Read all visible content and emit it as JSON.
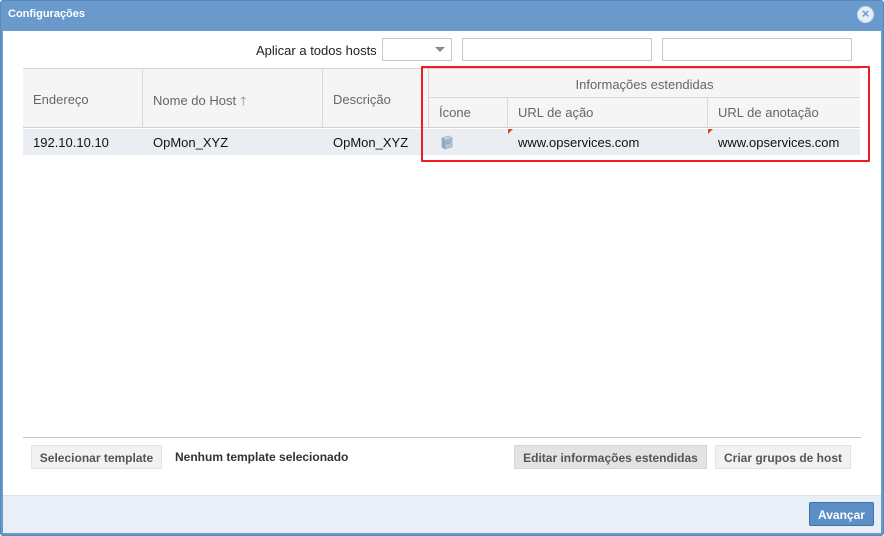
{
  "window": {
    "title": "Configurações",
    "close_symbol": "×"
  },
  "apply_all": {
    "label": "Aplicar a todos hosts",
    "select_value": "",
    "field1_value": "",
    "field2_value": ""
  },
  "grid": {
    "columns": {
      "address": "Endereço",
      "host_name": "Nome do Host",
      "description": "Descrição"
    },
    "extended_group": "Informações estendidas",
    "extended_columns": {
      "icon": "Ícone",
      "action_url": "URL de ação",
      "notes_url": "URL de anotação"
    },
    "sort_symbol": "🡑",
    "rows": [
      {
        "address": "192.10.10.10",
        "host_name": "OpMon_XYZ",
        "description": "OpMon_XYZ",
        "icon": "server-icon",
        "action_url": "www.opservices.com",
        "notes_url": "www.opservices.com"
      }
    ]
  },
  "toolbar": {
    "select_template": "Selecionar template",
    "template_status": "Nenhum template selecionado",
    "edit_extended": "Editar informações estendidas",
    "create_groups": "Criar grupos de host"
  },
  "footer": {
    "next": "Avançar"
  },
  "colors": {
    "titlebar": "#6a9acc",
    "highlight": "#ee1b24",
    "primary": "#5b8fc6",
    "dirty_marker": "#e0452c"
  }
}
